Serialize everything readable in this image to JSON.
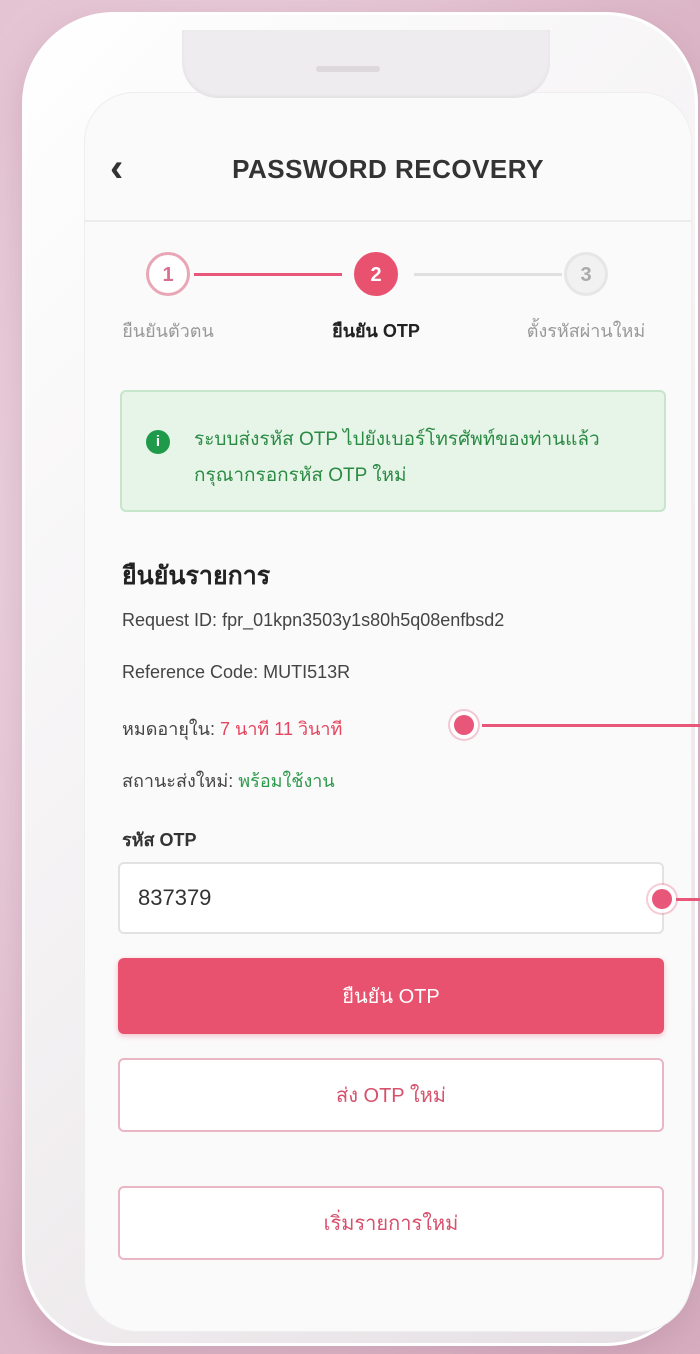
{
  "header": {
    "back_icon": "chevron-left-icon",
    "back_glyph": "‹",
    "title": "PASSWORD RECOVERY"
  },
  "stepper": {
    "current_step": 2,
    "steps": [
      {
        "number": "1",
        "label": "ยืนยันตัวตน",
        "state": "done"
      },
      {
        "number": "2",
        "label": "ยืนยัน OTP",
        "state": "active"
      },
      {
        "number": "3",
        "label": "ตั้งรหัสผ่านใหม่",
        "state": "pending"
      }
    ]
  },
  "alert": {
    "icon": "info-circle-icon",
    "glyph": "i",
    "text": "ระบบส่งรหัส OTP ไปยังเบอร์โทรศัพท์ของท่านแล้ว กรุณากรอกรหัส OTP ใหม่"
  },
  "details": {
    "section_title": "ยืนยันรายการ",
    "request_id_label": "Request ID:",
    "request_id_value": "fpr_01kpn3503y1s80h5q08enfbsd2",
    "reference_label": "Reference Code:",
    "reference_value": "MUTI513R",
    "countdown_label": "หมดอายุใน:",
    "countdown_value": "7 นาที 11 วินาที",
    "status_label": "สถานะส่งใหม่:",
    "status_value": "พร้อมใช้งาน"
  },
  "otp": {
    "label": "รหัส OTP",
    "value": "837379",
    "placeholder": ""
  },
  "buttons": {
    "confirm_label": "ยืนยัน OTP",
    "resend_label": "ส่ง OTP ใหม่",
    "restart_label": "เริ่มรายการใหม่"
  },
  "colors": {
    "primary": "#e8526f",
    "success": "#2f9a4d",
    "alert_bg": "#e6f5e8",
    "danger_text": "#e4455f"
  }
}
